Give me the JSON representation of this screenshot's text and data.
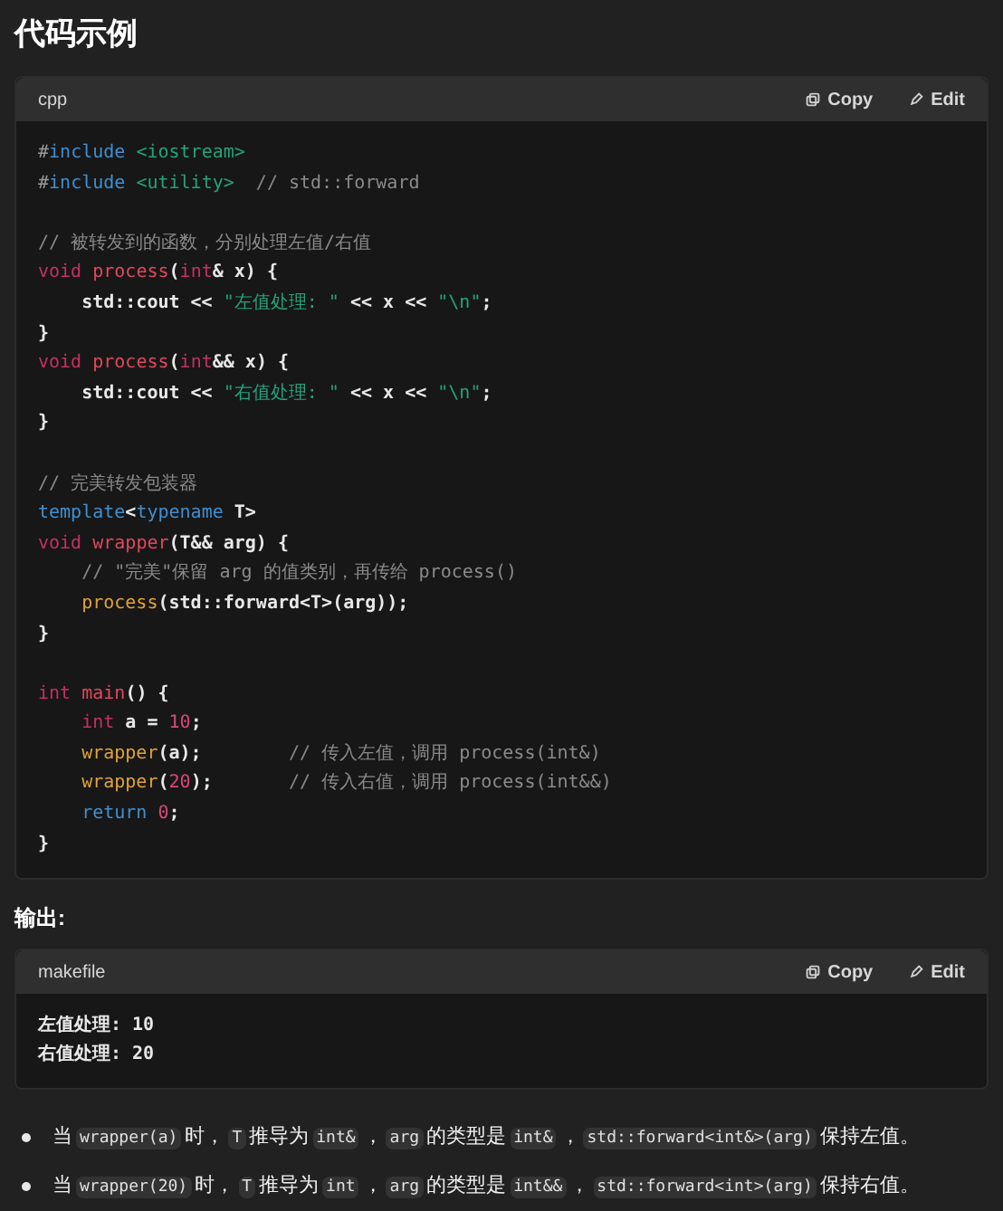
{
  "title": "代码示例",
  "code_block": {
    "language": "cpp",
    "actions": [
      {
        "kind": "copy",
        "label": "Copy"
      },
      {
        "kind": "edit",
        "label": "Edit"
      }
    ],
    "lines": [
      {
        "kind": "code",
        "tokens": [
          {
            "kind": "punct",
            "text": "#"
          },
          {
            "kind": "keyword",
            "text": "include "
          },
          {
            "kind": "string",
            "text": "<iostream>"
          }
        ]
      },
      {
        "kind": "code",
        "tokens": [
          {
            "kind": "punct",
            "text": "#"
          },
          {
            "kind": "keyword",
            "text": "include "
          },
          {
            "kind": "string",
            "text": "<utility>"
          },
          {
            "kind": "comment",
            "text": "  // std::forward"
          }
        ]
      },
      {
        "kind": "blank"
      },
      {
        "kind": "code",
        "tokens": [
          {
            "kind": "comment",
            "text": "// 被转发到的函数，分别处理左值/右值"
          }
        ]
      },
      {
        "kind": "code",
        "tokens": [
          {
            "kind": "type",
            "text": "void "
          },
          {
            "kind": "func",
            "text": "process"
          },
          {
            "kind": "plain",
            "text": "("
          },
          {
            "kind": "type",
            "text": "int"
          },
          {
            "kind": "plain",
            "text": "& x) {"
          }
        ]
      },
      {
        "kind": "code",
        "tokens": [
          {
            "kind": "plain",
            "text": "    std::cout << "
          },
          {
            "kind": "string",
            "text": "\"左值处理: \""
          },
          {
            "kind": "plain",
            "text": " << x << "
          },
          {
            "kind": "string",
            "text": "\"\\n\""
          },
          {
            "kind": "plain",
            "text": ";"
          }
        ]
      },
      {
        "kind": "code",
        "tokens": [
          {
            "kind": "plain",
            "text": "}"
          }
        ]
      },
      {
        "kind": "code",
        "tokens": [
          {
            "kind": "type",
            "text": "void "
          },
          {
            "kind": "func",
            "text": "process"
          },
          {
            "kind": "plain",
            "text": "("
          },
          {
            "kind": "type",
            "text": "int"
          },
          {
            "kind": "plain",
            "text": "&& x) {"
          }
        ]
      },
      {
        "kind": "code",
        "tokens": [
          {
            "kind": "plain",
            "text": "    std::cout << "
          },
          {
            "kind": "string",
            "text": "\"右值处理: \""
          },
          {
            "kind": "plain",
            "text": " << x << "
          },
          {
            "kind": "string",
            "text": "\"\\n\""
          },
          {
            "kind": "plain",
            "text": ";"
          }
        ]
      },
      {
        "kind": "code",
        "tokens": [
          {
            "kind": "plain",
            "text": "}"
          }
        ]
      },
      {
        "kind": "blank"
      },
      {
        "kind": "code",
        "tokens": [
          {
            "kind": "comment",
            "text": "// 完美转发包装器"
          }
        ]
      },
      {
        "kind": "code",
        "tokens": [
          {
            "kind": "keyword",
            "text": "template"
          },
          {
            "kind": "plain",
            "text": "<"
          },
          {
            "kind": "keyword",
            "text": "typename"
          },
          {
            "kind": "plain",
            "text": " T>"
          }
        ]
      },
      {
        "kind": "code",
        "tokens": [
          {
            "kind": "type",
            "text": "void "
          },
          {
            "kind": "func",
            "text": "wrapper"
          },
          {
            "kind": "plain",
            "text": "(T&& arg) {"
          }
        ]
      },
      {
        "kind": "code",
        "tokens": [
          {
            "kind": "comment",
            "text": "    // \"完美\"保留 arg 的值类别，再传给 process()"
          }
        ]
      },
      {
        "kind": "code",
        "tokens": [
          {
            "kind": "call",
            "text": "    process"
          },
          {
            "kind": "plain",
            "text": "(std::forward<T>(arg));"
          }
        ]
      },
      {
        "kind": "code",
        "tokens": [
          {
            "kind": "plain",
            "text": "}"
          }
        ]
      },
      {
        "kind": "blank"
      },
      {
        "kind": "code",
        "tokens": [
          {
            "kind": "type",
            "text": "int "
          },
          {
            "kind": "func",
            "text": "main"
          },
          {
            "kind": "plain",
            "text": "() {"
          }
        ]
      },
      {
        "kind": "code",
        "tokens": [
          {
            "kind": "type",
            "text": "    int"
          },
          {
            "kind": "plain",
            "text": " a = "
          },
          {
            "kind": "number",
            "text": "10"
          },
          {
            "kind": "plain",
            "text": ";"
          }
        ]
      },
      {
        "kind": "code",
        "tokens": [
          {
            "kind": "call",
            "text": "    wrapper"
          },
          {
            "kind": "plain",
            "text": "(a);        "
          },
          {
            "kind": "comment",
            "text": "// 传入左值，调用 process(int&)"
          }
        ]
      },
      {
        "kind": "code",
        "tokens": [
          {
            "kind": "call",
            "text": "    wrapper"
          },
          {
            "kind": "plain",
            "text": "("
          },
          {
            "kind": "number",
            "text": "20"
          },
          {
            "kind": "plain",
            "text": ");       "
          },
          {
            "kind": "comment",
            "text": "// 传入右值，调用 process(int&&)"
          }
        ]
      },
      {
        "kind": "code",
        "tokens": [
          {
            "kind": "keyword",
            "text": "    return "
          },
          {
            "kind": "number",
            "text": "0"
          },
          {
            "kind": "plain",
            "text": ";"
          }
        ]
      },
      {
        "kind": "code",
        "tokens": [
          {
            "kind": "plain",
            "text": "}"
          }
        ]
      }
    ]
  },
  "output_label": "输出:",
  "output_block": {
    "language": "makefile",
    "actions": [
      {
        "kind": "copy",
        "label": "Copy"
      },
      {
        "kind": "edit",
        "label": "Edit"
      }
    ],
    "lines": [
      "左值处理: 10",
      "右值处理: 20"
    ]
  },
  "bullets": [
    [
      {
        "kind": "text",
        "text": "当"
      },
      {
        "kind": "code",
        "text": "wrapper(a)"
      },
      {
        "kind": "text",
        "text": "时，"
      },
      {
        "kind": "code",
        "text": "T"
      },
      {
        "kind": "text",
        "text": "推导为"
      },
      {
        "kind": "code",
        "text": "int&"
      },
      {
        "kind": "text",
        "text": "，"
      },
      {
        "kind": "code",
        "text": "arg"
      },
      {
        "kind": "text",
        "text": "的类型是"
      },
      {
        "kind": "code",
        "text": "int&"
      },
      {
        "kind": "text",
        "text": "，"
      },
      {
        "kind": "code",
        "text": "std::forward<int&>(arg)"
      },
      {
        "kind": "text",
        "text": "保持左值。"
      }
    ],
    [
      {
        "kind": "text",
        "text": "当"
      },
      {
        "kind": "code",
        "text": "wrapper(20)"
      },
      {
        "kind": "text",
        "text": "时，"
      },
      {
        "kind": "code",
        "text": "T"
      },
      {
        "kind": "text",
        "text": "推导为"
      },
      {
        "kind": "code",
        "text": "int"
      },
      {
        "kind": "text",
        "text": "，"
      },
      {
        "kind": "code",
        "text": "arg"
      },
      {
        "kind": "text",
        "text": "的类型是"
      },
      {
        "kind": "code",
        "text": "int&&"
      },
      {
        "kind": "text",
        "text": "，"
      },
      {
        "kind": "code",
        "text": "std::forward<int>(arg)"
      },
      {
        "kind": "text",
        "text": "保持右值。"
      }
    ]
  ]
}
